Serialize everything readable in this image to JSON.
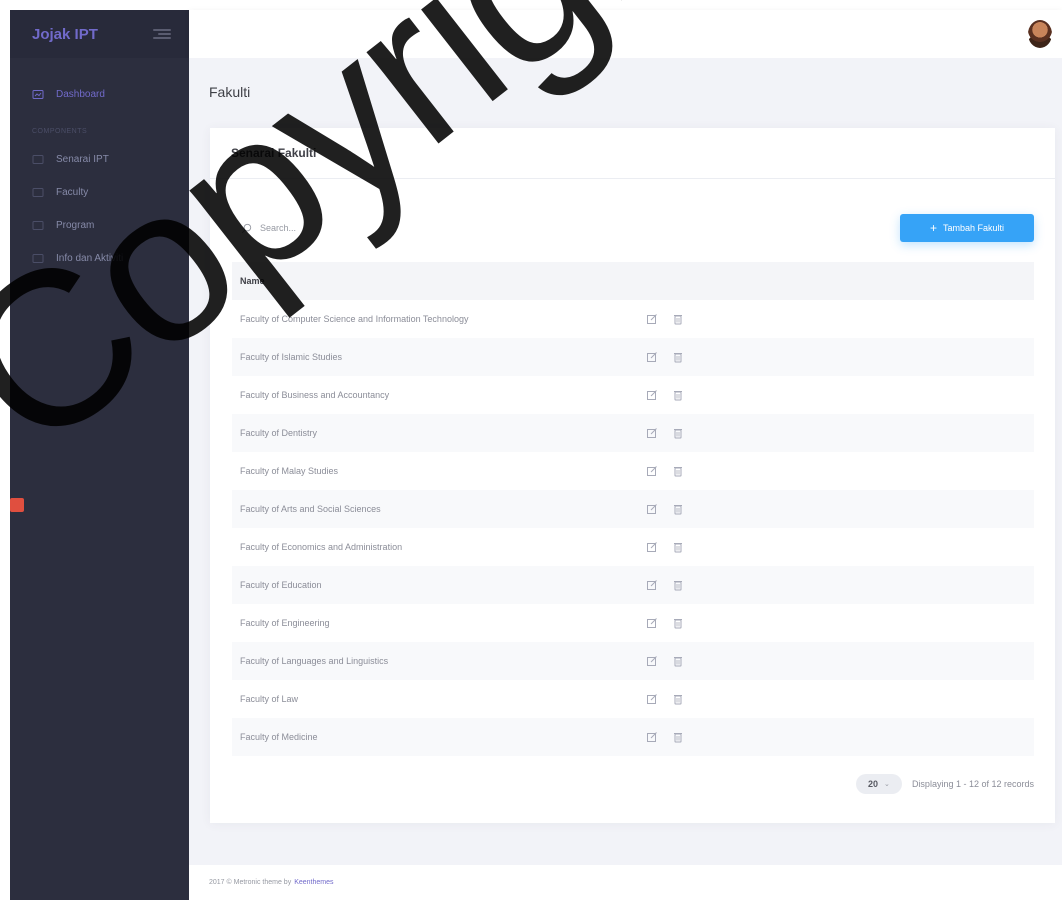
{
  "sidebar": {
    "brand": "Jojak IPT",
    "dashboard": "Dashboard",
    "section": "COMPONENTS",
    "items": [
      {
        "label": "Senarai IPT"
      },
      {
        "label": "Faculty"
      },
      {
        "label": "Program"
      },
      {
        "label": "Info dan Aktiviti"
      }
    ]
  },
  "page": {
    "title": "Fakulti"
  },
  "portlet": {
    "title": "Senarai Fakulti",
    "search_placeholder": "Search...",
    "add_button": "Tambah Fakulti"
  },
  "table": {
    "header": "Name",
    "rows": [
      "Faculty of Computer Science and Information Technology",
      "Faculty of Islamic Studies",
      "Faculty of Business and Accountancy",
      "Faculty of Dentistry",
      "Faculty of Malay Studies",
      "Faculty of Arts and Social Sciences",
      "Faculty of Economics and Administration",
      "Faculty of Education",
      "Faculty of Engineering",
      "Faculty of Languages and Linguistics",
      "Faculty of Law",
      "Faculty of Medicine"
    ]
  },
  "pager": {
    "page_size": "20",
    "info": "Displaying 1 - 12 of 12 records"
  },
  "footer": {
    "text": "2017 © Metronic theme by",
    "link": "Keenthemes"
  },
  "watermark": "Copyright@",
  "colors": {
    "accent": "#716aca",
    "primary_button": "#36a3f7",
    "sidebar_bg": "#2c2e3e"
  }
}
